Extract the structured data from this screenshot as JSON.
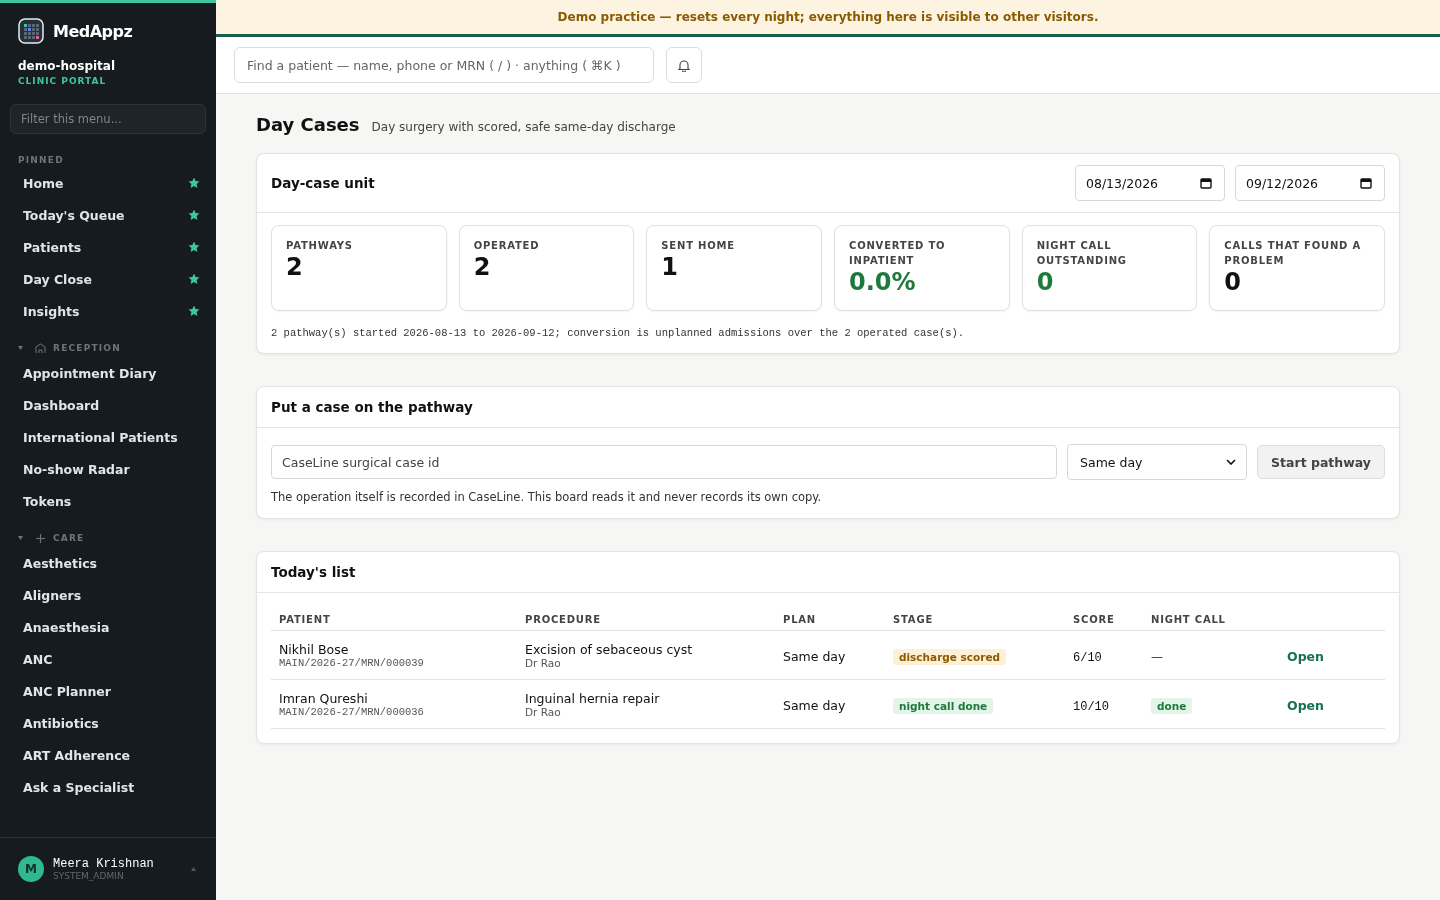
{
  "brand": {
    "name": "MedAppz",
    "org": "demo-hospital",
    "portal": "CLINIC PORTAL"
  },
  "sidebar": {
    "filter_placeholder": "Filter this menu...",
    "sections": [
      {
        "kind": "pinned",
        "title": "PINNED",
        "items": [
          {
            "label": "Home",
            "pinned": true
          },
          {
            "label": "Today's Queue",
            "pinned": true
          },
          {
            "label": "Patients",
            "pinned": true
          },
          {
            "label": "Day Close",
            "pinned": true
          },
          {
            "label": "Insights",
            "pinned": true
          }
        ]
      },
      {
        "kind": "reception",
        "title": "RECEPTION",
        "expanded": true,
        "items": [
          {
            "label": "Appointment Diary",
            "pinned": false
          },
          {
            "label": "Dashboard",
            "pinned": false
          },
          {
            "label": "International Patients",
            "pinned": false
          },
          {
            "label": "No-show Radar",
            "pinned": false
          },
          {
            "label": "Tokens",
            "pinned": false
          }
        ]
      },
      {
        "kind": "care",
        "title": "CARE",
        "expanded": true,
        "items": [
          {
            "label": "Aesthetics",
            "pinned": false
          },
          {
            "label": "Aligners",
            "pinned": false
          },
          {
            "label": "Anaesthesia",
            "pinned": false
          },
          {
            "label": "ANC",
            "pinned": false
          },
          {
            "label": "ANC Planner",
            "pinned": false
          },
          {
            "label": "Antibiotics",
            "pinned": false
          },
          {
            "label": "ART Adherence",
            "pinned": false
          },
          {
            "label": "Ask a Specialist",
            "pinned": false
          }
        ]
      }
    ],
    "user": {
      "initial": "M",
      "name": "Meera Krishnan",
      "role": "SYSTEM_ADMIN"
    }
  },
  "banner": "Demo practice — resets every night; everything here is visible to other visitors.",
  "search": {
    "placeholder": "Find a patient — name, phone or MRN ( / ) · anything ( ⌘K )"
  },
  "page": {
    "title": "Day Cases",
    "subtitle": "Day surgery with scored, safe same-day discharge"
  },
  "unit": {
    "title": "Day-case unit",
    "date_from": "08/13/2026",
    "date_to": "09/12/2026",
    "stats": [
      {
        "label": "PATHWAYS",
        "value": "2",
        "color": "#111111"
      },
      {
        "label": "OPERATED",
        "value": "2",
        "color": "#111111"
      },
      {
        "label": "SENT HOME",
        "value": "1",
        "color": "#111111"
      },
      {
        "label": "CONVERTED TO INPATIENT",
        "value": "0.0%",
        "color": "#1e7a3c"
      },
      {
        "label": "NIGHT CALL OUTSTANDING",
        "value": "0",
        "color": "#1e7a3c"
      },
      {
        "label": "CALLS THAT FOUND A PROBLEM",
        "value": "0",
        "color": "#111111"
      }
    ],
    "note": "2 pathway(s) started 2026-08-13 to 2026-09-12; conversion is unplanned admissions over the 2 operated case(s)."
  },
  "pathway": {
    "title": "Put a case on the pathway",
    "placeholder": "CaseLine surgical case id",
    "plan": "Same day",
    "button": "Start pathway",
    "note": "The operation itself is recorded in CaseLine. This board reads it and never records its own copy."
  },
  "list": {
    "title": "Today's list",
    "columns": [
      "PATIENT",
      "PROCEDURE",
      "PLAN",
      "STAGE",
      "SCORE",
      "NIGHT CALL"
    ],
    "rows": [
      {
        "patient": "Nikhil Bose",
        "mrn": "MAIN/2026-27/MRN/000039",
        "procedure": "Excision of sebaceous cyst",
        "doctor": "Dr Rao",
        "plan": "Same day",
        "stage": {
          "text": "discharge scored",
          "kind": "amber"
        },
        "score": "6/10",
        "night_call": {
          "text": "—",
          "kind": "text"
        },
        "action": "Open"
      },
      {
        "patient": "Imran Qureshi",
        "mrn": "MAIN/2026-27/MRN/000036",
        "procedure": "Inguinal hernia repair",
        "doctor": "Dr Rao",
        "plan": "Same day",
        "stage": {
          "text": "night call done",
          "kind": "green"
        },
        "score": "10/10",
        "night_call": {
          "text": "done",
          "kind": "badge"
        },
        "action": "Open"
      }
    ]
  }
}
